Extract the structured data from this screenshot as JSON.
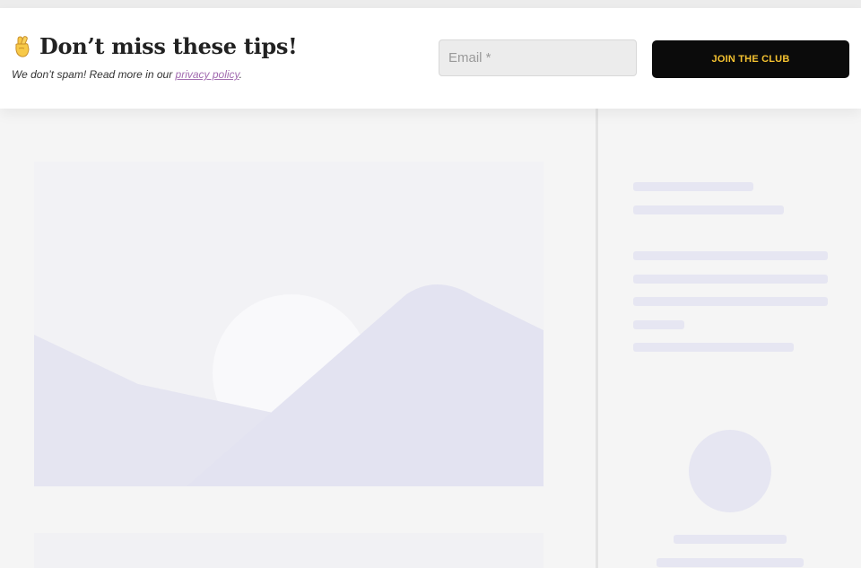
{
  "banner": {
    "emoji": "🤞",
    "title": "Don’t miss these tips!",
    "subtitle_prefix": "We don’t spam! Read more in our ",
    "privacy_link": "privacy policy",
    "subtitle_suffix": ".",
    "email_placeholder": "Email *",
    "join_label": "JOIN THE CLUB"
  },
  "colors": {
    "button_bg": "#0b0b0b",
    "button_text": "#f4c230",
    "link": "#a26bb0",
    "skeleton": "#e6e6f2",
    "image_placeholder_bg": "#f2f2f5"
  }
}
